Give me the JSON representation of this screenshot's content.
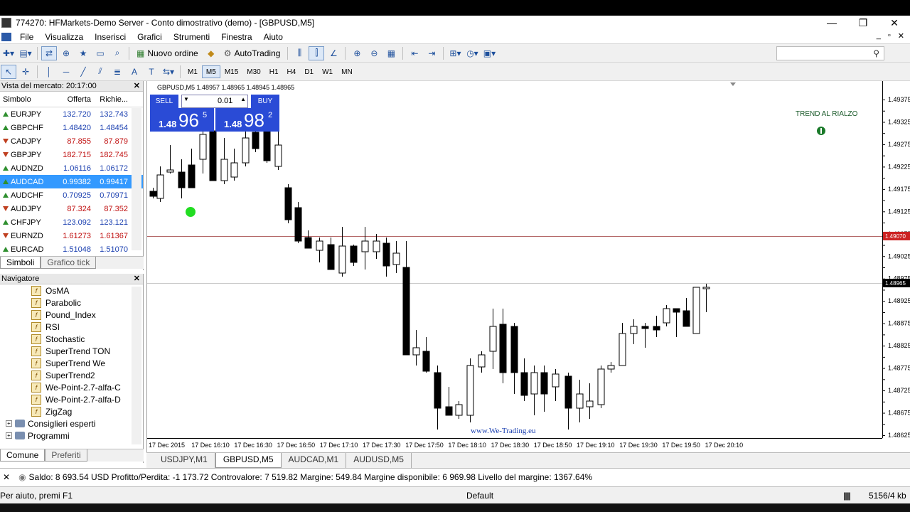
{
  "window": {
    "title": "774270: HFMarkets-Demo Server - Conto dimostrativo (demo) - [GBPUSD,M5]",
    "min": "—",
    "max": "❐",
    "close": "✕"
  },
  "menu": [
    "File",
    "Visualizza",
    "Inserisci",
    "Grafici",
    "Strumenti",
    "Finestra",
    "Aiuto"
  ],
  "toolbar": {
    "new_order": "Nuovo ordine",
    "autotrading": "AutoTrading",
    "timeframes": [
      "M1",
      "M5",
      "M15",
      "M30",
      "H1",
      "H4",
      "D1",
      "W1",
      "MN"
    ],
    "selected_timeframe": "M5"
  },
  "market_watch": {
    "title": "Vista del mercato: 20:17:00",
    "headers": {
      "symbol": "Simbolo",
      "bid": "Offerta",
      "ask": "Richie..."
    },
    "rows": [
      {
        "symbol": "EURJPY",
        "bid": "132.720",
        "ask": "132.743",
        "dir": "up",
        "color": "blue"
      },
      {
        "symbol": "GBPCHF",
        "bid": "1.48420",
        "ask": "1.48454",
        "dir": "up",
        "color": "blue"
      },
      {
        "symbol": "CADJPY",
        "bid": "87.855",
        "ask": "87.879",
        "dir": "down",
        "color": "red"
      },
      {
        "symbol": "GBPJPY",
        "bid": "182.715",
        "ask": "182.745",
        "dir": "down",
        "color": "red"
      },
      {
        "symbol": "AUDNZD",
        "bid": "1.06116",
        "ask": "1.06172",
        "dir": "up",
        "color": "blue"
      },
      {
        "symbol": "AUDCAD",
        "bid": "0.99382",
        "ask": "0.99417",
        "dir": "up",
        "color": "blue"
      },
      {
        "symbol": "AUDCHF",
        "bid": "0.70925",
        "ask": "0.70971",
        "dir": "up",
        "color": "blue"
      },
      {
        "symbol": "AUDJPY",
        "bid": "87.324",
        "ask": "87.352",
        "dir": "down",
        "color": "red"
      },
      {
        "symbol": "CHFJPY",
        "bid": "123.092",
        "ask": "123.121",
        "dir": "up",
        "color": "blue"
      },
      {
        "symbol": "EURNZD",
        "bid": "1.61273",
        "ask": "1.61367",
        "dir": "down",
        "color": "red"
      },
      {
        "symbol": "EURCAD",
        "bid": "1.51048",
        "ask": "1.51070",
        "dir": "up",
        "color": "blue"
      }
    ],
    "selected_index": 5,
    "tabs": [
      "Simboli",
      "Grafico tick"
    ]
  },
  "navigator": {
    "title": "Navigatore",
    "indicators": [
      "OsMA",
      "Parabolic",
      "Pound_Index",
      "RSI",
      "Stochastic",
      "SuperTrend TON",
      "SuperTrend We",
      "SuperTrend2",
      "We-Point-2.7-alfa-C",
      "We-Point-2.7-alfa-D",
      "ZigZag"
    ],
    "folders": [
      "Consiglieri esperti",
      "Programmi"
    ],
    "tabs": [
      "Comune",
      "Preferiti"
    ]
  },
  "chart": {
    "header": "GBPUSD,M5  1.48957 1.48965 1.48945 1.48965",
    "one_click": {
      "sell": "SELL",
      "buy": "BUY",
      "lot": "0.01",
      "sell_small": "1.48",
      "sell_big": "96",
      "sell_sup": "5",
      "buy_small": "1.48",
      "buy_big": "98",
      "buy_sup": "2"
    },
    "trend_label": "TREND AL RIALZO",
    "watermark": "www.We-Trading.eu",
    "price_labels": [
      "1.49375",
      "1.49350",
      "1.49325",
      "1.49300",
      "1.49275",
      "1.49250",
      "1.49225",
      "1.49200",
      "1.49175",
      "1.49150",
      "1.49125",
      "1.49100",
      "1.49075",
      "1.49050",
      "1.49025",
      "1.49000",
      "1.48975",
      "1.48950",
      "1.48925",
      "1.48900",
      "1.48875",
      "1.48850",
      "1.48825",
      "1.48800",
      "1.48775",
      "1.48750",
      "1.48725",
      "1.48700",
      "1.48675",
      "1.48650",
      "1.48625"
    ],
    "hline_red_label": "1.49070",
    "current_price_label": "1.48965",
    "time_labels": [
      "17 Dec 2015",
      "17 Dec 16:10",
      "17 Dec 16:30",
      "17 Dec 16:50",
      "17 Dec 17:10",
      "17 Dec 17:30",
      "17 Dec 17:50",
      "17 Dec 18:10",
      "17 Dec 18:30",
      "17 Dec 18:50",
      "17 Dec 19:10",
      "17 Dec 19:30",
      "17 Dec 19:50",
      "17 Dec 20:10"
    ],
    "colors": {
      "bull": "#ffffff",
      "bear": "#000000",
      "red_line": "#b06060",
      "dot": "#22dd22",
      "label_bg": "#cc2222"
    }
  },
  "chart_tabs": [
    "USDJPY,M1",
    "GBPUSD,M5",
    "AUDCAD,M1",
    "AUDUSD,M5"
  ],
  "chart_tab_active": 1,
  "account": "Saldo: 8 693.54 USD  Profitto/Perdita: -1 173.72  Controvalore: 7 519.82  Margine: 549.84  Margine disponibile: 6 969.98  Livello del margine: 1367.64%",
  "status": {
    "help": "Per aiuto, premi F1",
    "profile": "Default",
    "traffic": "5156/4 kb"
  }
}
